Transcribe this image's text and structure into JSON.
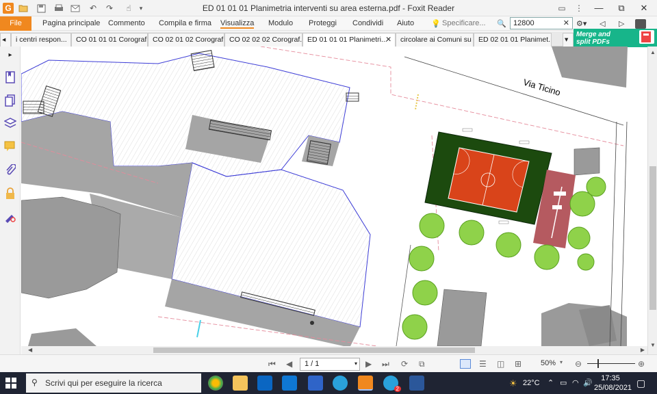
{
  "window": {
    "title": "ED 01 01 01 Planimetria interventi su area esterna.pdf - Foxit Reader",
    "minimize": "—",
    "maximize": "⧉",
    "close": "✕"
  },
  "menubar": {
    "file": "File",
    "items": [
      "Pagina principale",
      "Commento",
      "Compila e firma",
      "Visualizza",
      "Modulo",
      "Proteggi",
      "Condividi",
      "Aiuto"
    ],
    "tell_me_placeholder": "Specificare...",
    "zoom_search_value": "12800"
  },
  "tabs": [
    {
      "label": "i centri respon..."
    },
    {
      "label": "CO 01 01 01 Corograf..."
    },
    {
      "label": "CO 02 01 02 Corograf..."
    },
    {
      "label": "CO 02 02 02 Corograf..."
    },
    {
      "label": "ED 01 01 01 Planimetri..."
    },
    {
      "label": "circolare ai Comuni su ..."
    },
    {
      "label": "ED 02 01 01 Planimet..."
    }
  ],
  "banner": {
    "line1": "Merge and",
    "line2": "split PDFs"
  },
  "map": {
    "street_label": "Via Ticino"
  },
  "statusbar": {
    "page_indicator": "1 / 1",
    "zoom": "50%"
  },
  "taskbar": {
    "search_placeholder": "Scrivi qui per eseguire la ricerca",
    "temperature": "22°C",
    "time": "17:35",
    "date": "25/08/2021",
    "telegram_badge": "2"
  },
  "colors": {
    "foxit_orange": "#f0881f",
    "merge_green": "#17b58a",
    "field_green": "#1c4a0e",
    "court_red": "#d9441a",
    "building_gray": "#a5a5a5",
    "outline_blue": "#3b3bd6"
  }
}
